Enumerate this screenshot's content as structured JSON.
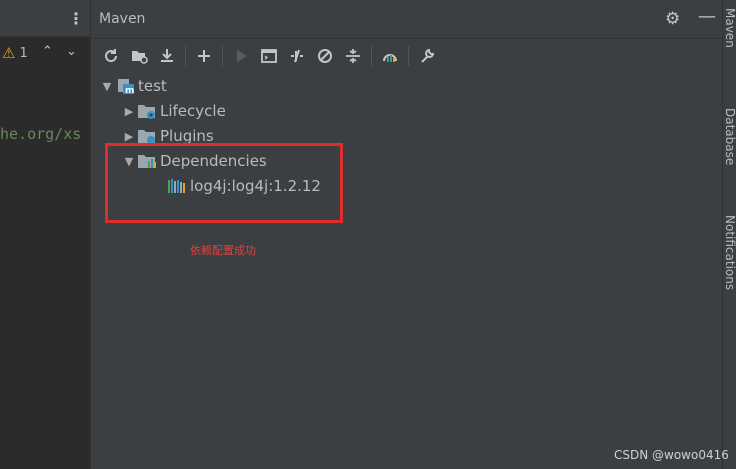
{
  "editor": {
    "menu_glyph": "⋮",
    "warning_count": "1",
    "code_fragment": "he.org/xs"
  },
  "maven": {
    "title": "Maven",
    "toolbar": [
      {
        "name": "reload-icon",
        "glyph": "↻"
      },
      {
        "name": "add-folder-icon",
        "glyph": "📁"
      },
      {
        "name": "download-icon",
        "glyph": "⤓"
      },
      {
        "name": "add-icon",
        "glyph": "+"
      },
      {
        "name": "run-icon",
        "glyph": "▶"
      },
      {
        "name": "execute-goal-icon",
        "glyph": "▣"
      },
      {
        "name": "toggle-offline-icon",
        "glyph": "⫽"
      },
      {
        "name": "skip-tests-icon",
        "glyph": "⊘"
      },
      {
        "name": "collapse-all-icon",
        "glyph": "≑"
      },
      {
        "name": "analyze-dependencies-icon",
        "glyph": "⊙"
      },
      {
        "name": "settings-wrench-icon",
        "glyph": "🔧"
      }
    ],
    "tree": {
      "root": "test",
      "lifecycle": "Lifecycle",
      "plugins": "Plugins",
      "dependencies": "Dependencies",
      "dependency_item": "log4j:log4j:1.2.12"
    }
  },
  "annotation": "依赖配置成功",
  "right_stripe": [
    "Maven",
    "Database",
    "Notifications"
  ],
  "watermark": "CSDN @wowo0416",
  "colors": {
    "panel": "#3c3f41",
    "editor": "#2b2b2b",
    "highlight": "#e22b2b",
    "warning": "#e0a52a",
    "maven_blue": "#3592c4"
  }
}
